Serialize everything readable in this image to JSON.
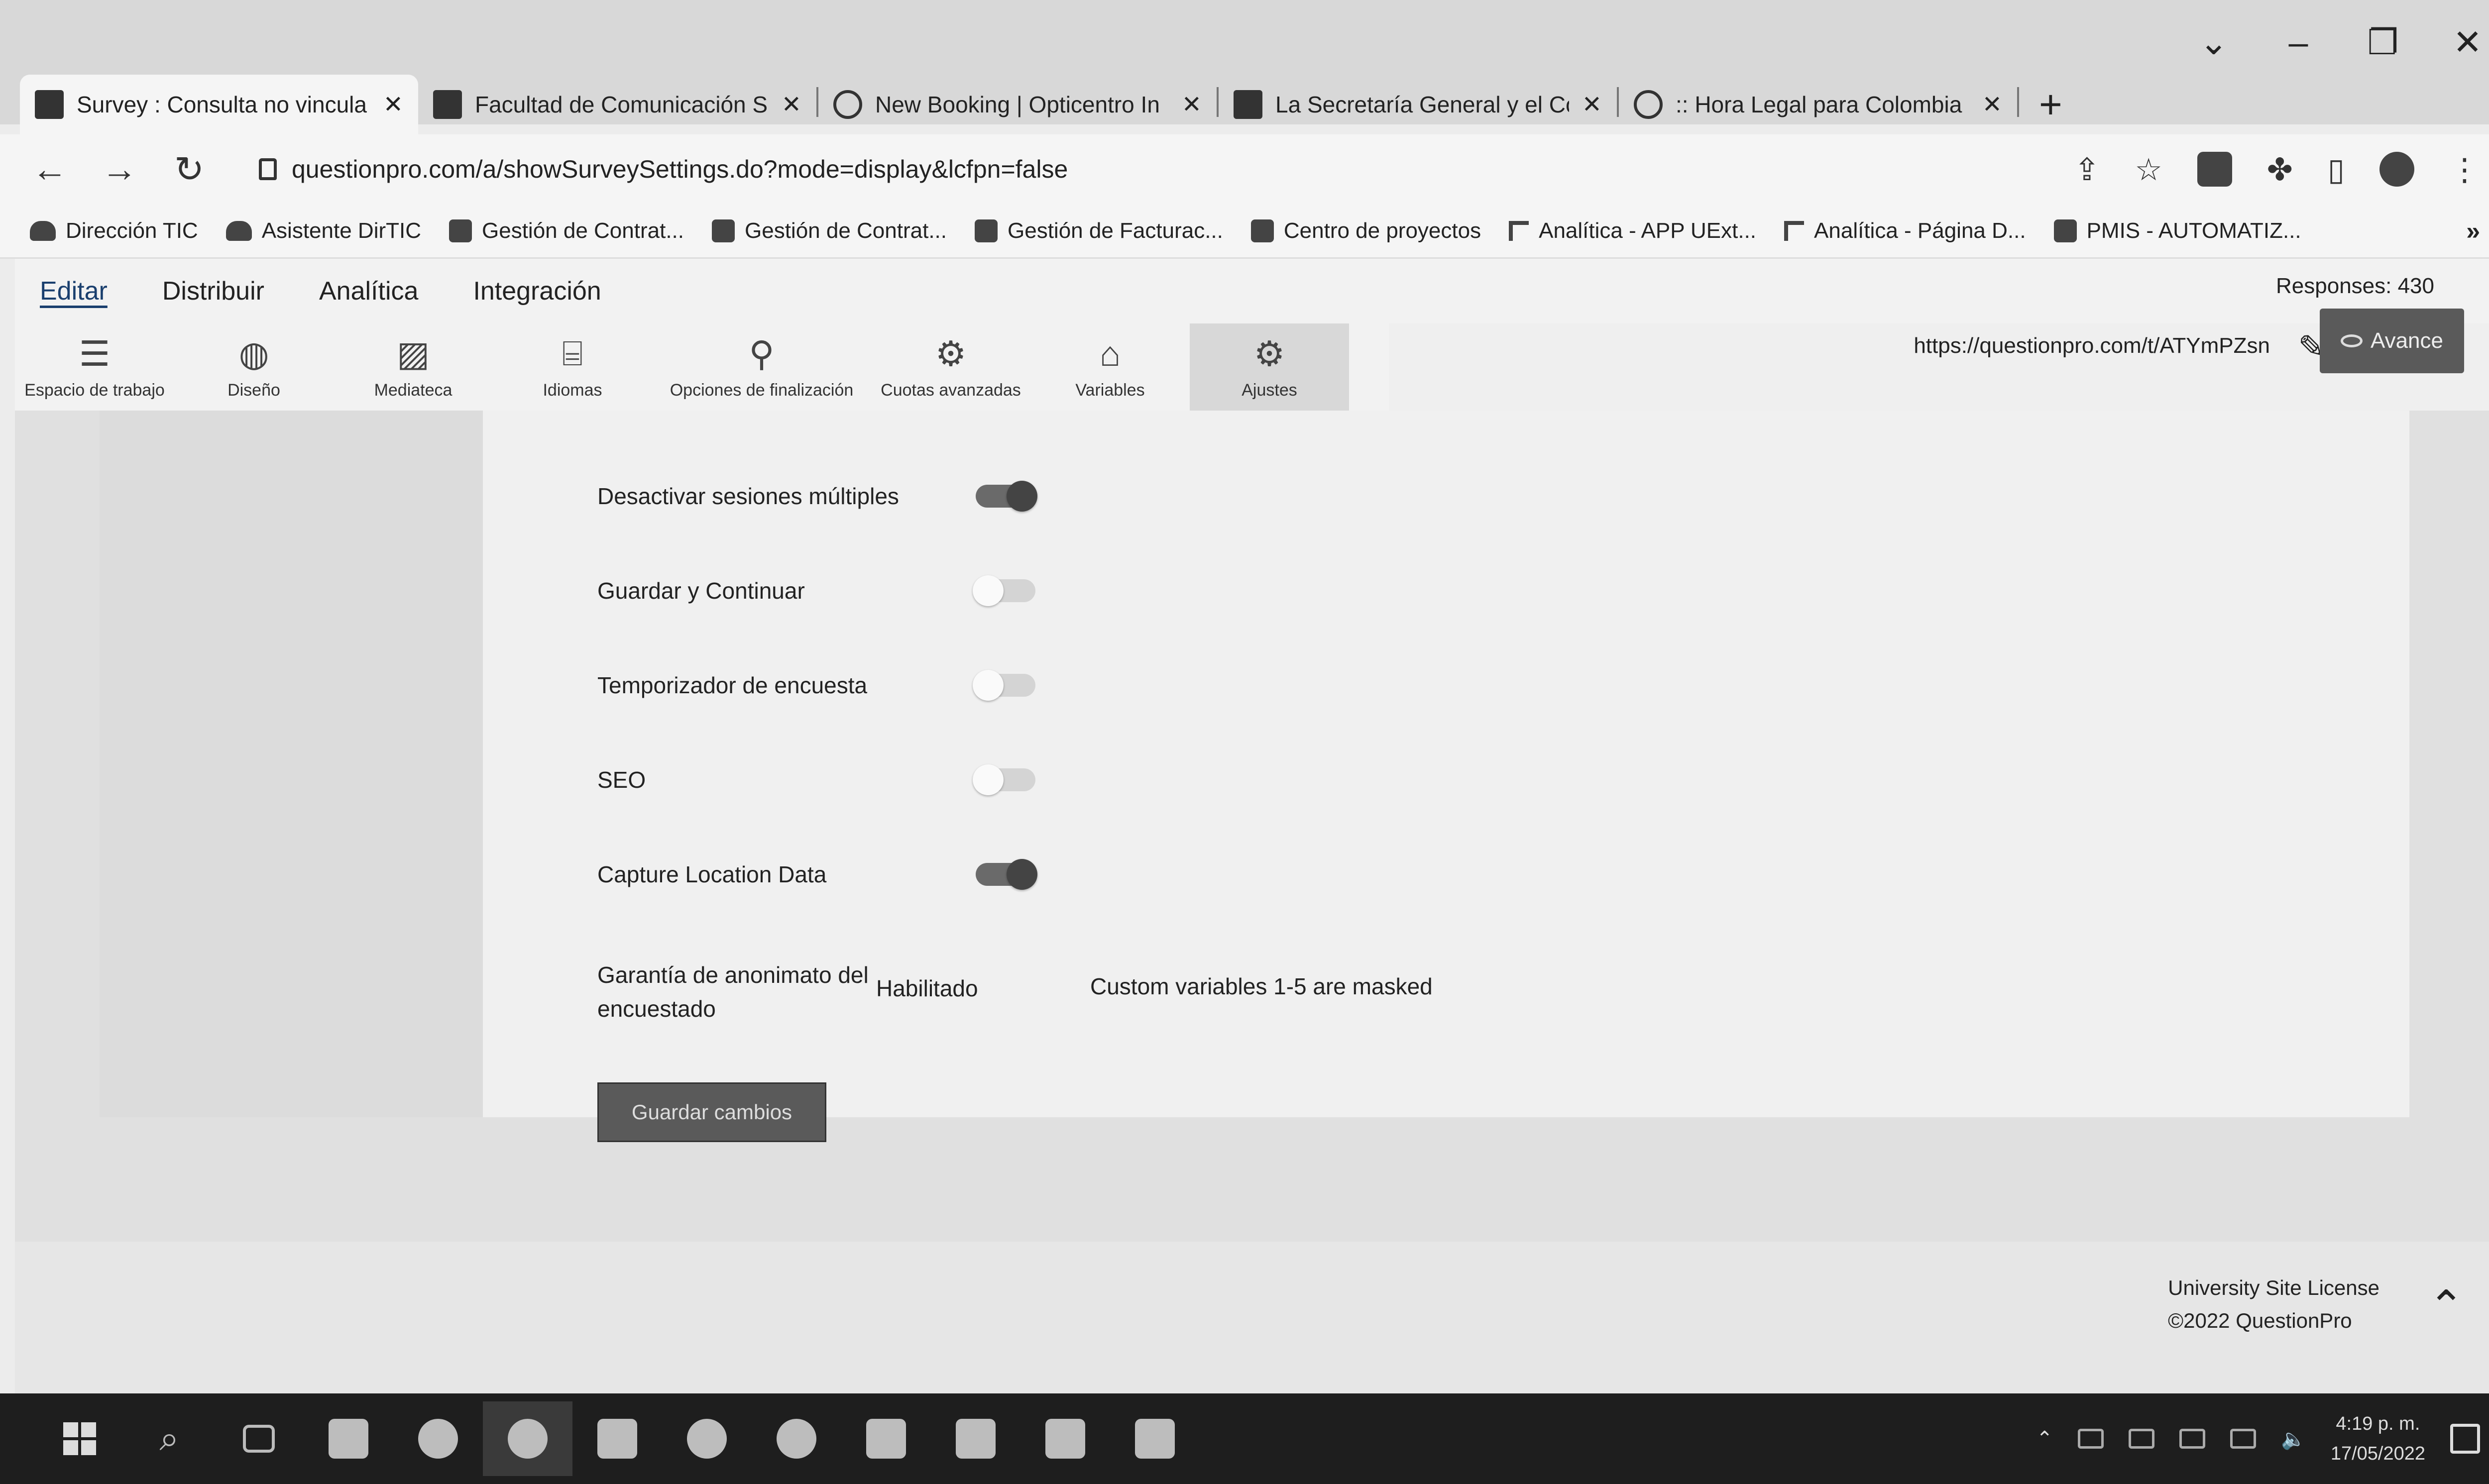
{
  "browser": {
    "tabs": [
      {
        "label": "Survey : Consulta no vincula",
        "active": true
      },
      {
        "label": "Facultad de Comunicación S",
        "active": false
      },
      {
        "label": "New Booking | Opticentro In",
        "active": false
      },
      {
        "label": "La Secretaría General y el Co",
        "active": false
      },
      {
        "label": ":: Hora Legal para Colombia",
        "active": false
      }
    ],
    "new_tab": "+",
    "url": "questionpro.com/a/showSurveySettings.do?mode=display&lcfpn=false",
    "bookmarks": [
      "Dirección TIC",
      "Asistente DirTIC",
      "Gestión de Contrat...",
      "Gestión de Contrat...",
      "Gestión de Facturac...",
      "Centro de proyectos",
      "Analítica - APP UExt...",
      "Analítica - Página D...",
      "PMIS - AUTOMATIZ..."
    ],
    "bookmarks_more": "»"
  },
  "app": {
    "menu": [
      "Editar",
      "Distribuir",
      "Analítica",
      "Integración"
    ],
    "responses": "Responses: 430",
    "survey_url": "https://questionpro.com/t/ATYmPZsn",
    "preview_label": "Avance",
    "toolbar": [
      {
        "label": "Espacio de trabajo",
        "icon": "list-icon"
      },
      {
        "label": "Diseño",
        "icon": "palette-icon"
      },
      {
        "label": "Mediateca",
        "icon": "image-icon"
      },
      {
        "label": "Idiomas",
        "icon": "translate-icon"
      },
      {
        "label": "Opciones de finalización",
        "icon": "magic-wand-icon"
      },
      {
        "label": "Cuotas avanzadas",
        "icon": "gears-icon"
      },
      {
        "label": "Variables",
        "icon": "tag-icon"
      },
      {
        "label": "Ajustes",
        "icon": "gear-icon"
      }
    ],
    "settings": [
      {
        "label": "Desactivar sesiones múltiples",
        "enabled": true
      },
      {
        "label": "Guardar y Continuar",
        "enabled": false
      },
      {
        "label": "Temporizador de encuesta",
        "enabled": false
      },
      {
        "label": "SEO",
        "enabled": false
      },
      {
        "label": "Capture Location Data",
        "enabled": true
      }
    ],
    "anonymity": {
      "label": "Garantía de anonimato del encuestado",
      "status": "Habilitado",
      "note": "Custom variables 1-5 are masked"
    },
    "save_label": "Guardar cambios",
    "footer": {
      "license": "University Site License",
      "copyright": "©2022 QuestionPro"
    }
  },
  "taskbar": {
    "time": "4:19 p. m.",
    "date": "17/05/2022"
  },
  "colors": {
    "toggle_on": "#444444",
    "toggle_off": "#d4d4d4",
    "button_dark": "#5a5a5a"
  }
}
